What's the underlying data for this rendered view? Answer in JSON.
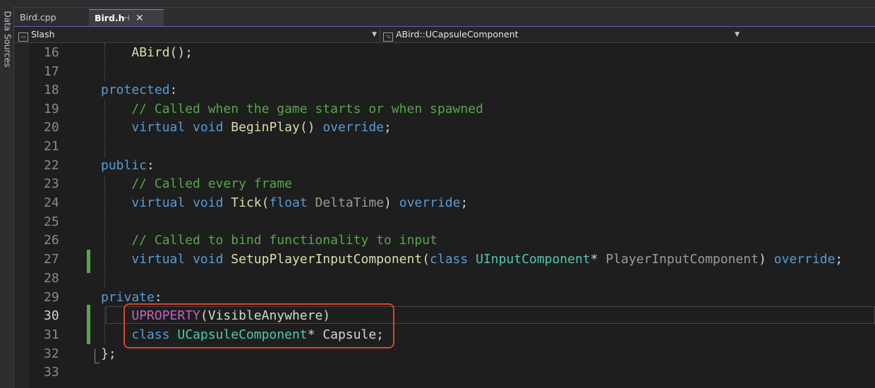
{
  "sidebar": {
    "label": "Data Sources"
  },
  "tabs": [
    {
      "label": "Bird.cpp",
      "active": false
    },
    {
      "label": "Bird.h",
      "active": true
    }
  ],
  "navbar": {
    "project": "Slash",
    "member": "ABird::UCapsuleComponent"
  },
  "editor": {
    "current_line": 30,
    "highlight_color": "#d9452b",
    "lines": [
      {
        "num": "16",
        "text": "    ABird();"
      },
      {
        "num": "17",
        "text": ""
      },
      {
        "num": "18",
        "text": "protected:"
      },
      {
        "num": "19",
        "text": "    // Called when the game starts or when spawned"
      },
      {
        "num": "20",
        "text": "    virtual void BeginPlay() override;"
      },
      {
        "num": "21",
        "text": ""
      },
      {
        "num": "22",
        "text": "public:"
      },
      {
        "num": "23",
        "text": "    // Called every frame"
      },
      {
        "num": "24",
        "text": "    virtual void Tick(float DeltaTime) override;"
      },
      {
        "num": "25",
        "text": ""
      },
      {
        "num": "26",
        "text": "    // Called to bind functionality to input"
      },
      {
        "num": "27",
        "text": "    virtual void SetupPlayerInputComponent(class UInputComponent* PlayerInputComponent) override;"
      },
      {
        "num": "28",
        "text": ""
      },
      {
        "num": "29",
        "text": "private:"
      },
      {
        "num": "30",
        "text": "    UPROPERTY(VisibleAnywhere)"
      },
      {
        "num": "31",
        "text": "    class UCapsuleComponent* Capsule;"
      },
      {
        "num": "32",
        "text": "};"
      },
      {
        "num": "33",
        "text": ""
      }
    ]
  }
}
